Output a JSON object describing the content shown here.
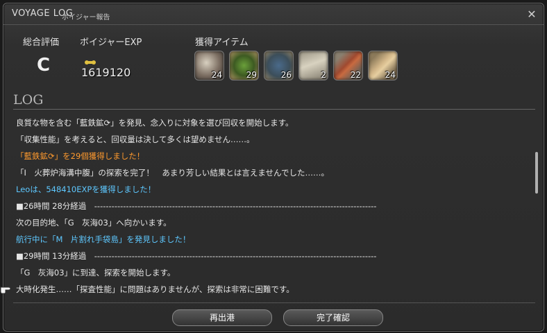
{
  "window": {
    "title": "VOYAGE LOG",
    "subtitle": "ボイジャー報告"
  },
  "summary": {
    "grade_label": "総合評価",
    "grade": "C",
    "exp_label": "ボイジャーEXP",
    "exp_value": "1619120",
    "items_label": "獲得アイテム",
    "items": [
      {
        "icon": "ore-sphere-icon",
        "qty": "24"
      },
      {
        "icon": "green-mineral-icon",
        "qty": "29"
      },
      {
        "icon": "blue-ore-icon",
        "qty": "26"
      },
      {
        "icon": "crystal-icon",
        "qty": "2"
      },
      {
        "icon": "log-red-icon",
        "qty": "22"
      },
      {
        "icon": "log-tan-icon",
        "qty": "24"
      }
    ]
  },
  "log": {
    "title": "LOG",
    "lines": [
      {
        "text": "良質な物を含む「藍鉄鉱⟳」を発見、念入りに対象を選び回収を開始します。",
        "color": "white"
      },
      {
        "text": "「収集性能」を考えると、回収量は決して多くは望めません……。",
        "color": "white"
      },
      {
        "text": "「藍鉄鉱⟳」を29個獲得しました！",
        "color": "orange"
      },
      {
        "text": "「I　火葬炉海溝中腹」の探索を完了！　あまり芳しい結果とは言えませんでした……。",
        "color": "white"
      },
      {
        "text": "Leoは、548410EXPを獲得しました！",
        "color": "blue"
      },
      {
        "text": "■26時間 28分経過　--------------------------------------------------------------------------------------------------",
        "color": "white"
      },
      {
        "text": "次の目的地、「G　灰海03」へ向かいます。",
        "color": "white"
      },
      {
        "text": "航行中に「M　片割れ手袋島」を発見しました！",
        "color": "blue"
      },
      {
        "text": "■29時間 13分経過　--------------------------------------------------------------------------------------------------",
        "color": "white"
      },
      {
        "text": "「G　灰海03」に到達、探索を開始します。",
        "color": "white"
      },
      {
        "text": "大時化発生……「探査性能」に問題はありませんが、探索は非常に困難です。",
        "color": "white"
      }
    ]
  },
  "buttons": {
    "redeploy": "再出港",
    "finalize": "完了確認"
  },
  "colors": {
    "orange": "#ff9a2e",
    "blue": "#5ec8ff",
    "white": "#e6e6e6"
  }
}
